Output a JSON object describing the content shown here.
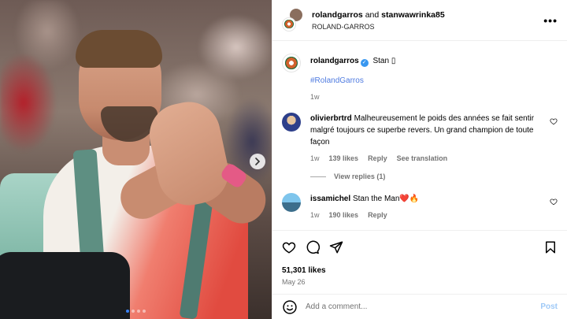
{
  "photo": {
    "carousel_dot_count": 4,
    "carousel_active_index": 0,
    "next_icon": "chevron-right-icon"
  },
  "header": {
    "author": "rolandgarros",
    "connector": "and",
    "collaborator": "stanwawrinka85",
    "subtitle": "ROLAND-GARROS",
    "more_label": "•••"
  },
  "caption": {
    "username": "rolandgarros",
    "text": "Stan",
    "trailing_glyph": "▯",
    "hashtag": "#RolandGarros",
    "time": "1w"
  },
  "comments": [
    {
      "username": "olivierbrtrd",
      "text": "Malheureusement le poids des années se fait sentir malgré toujours ce superbe revers. Un grand champion de toute façon",
      "time": "1w",
      "likes": "139 likes",
      "reply_label": "Reply",
      "translate_label": "See translation",
      "view_replies": "View replies (1)"
    },
    {
      "username": "issamichel",
      "text": "Stan the Man",
      "emoji": "❤️🔥",
      "time": "1w",
      "likes": "190 likes",
      "reply_label": "Reply"
    }
  ],
  "actions": {
    "likes": "51,301 likes",
    "date": "May 26"
  },
  "add_comment": {
    "placeholder": "Add a comment...",
    "post_label": "Post"
  },
  "colors": {
    "verified": "#3897f0",
    "hashtag": "#4f7be0",
    "post_disabled": "#9ec9f7",
    "active_dot": "#3b82f6"
  }
}
